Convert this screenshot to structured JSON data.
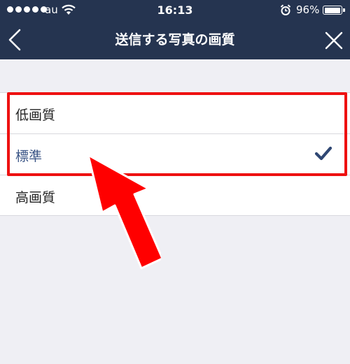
{
  "status_bar": {
    "carrier": "au",
    "time": "16:13",
    "battery_percent": "96%",
    "battery_level": 0.96
  },
  "nav": {
    "title": "送信する写真の画質",
    "back_icon": "chevron-left-icon",
    "close_icon": "close-icon"
  },
  "options": [
    {
      "label": "低画質",
      "selected": false
    },
    {
      "label": "標準",
      "selected": true
    },
    {
      "label": "高画質",
      "selected": false
    }
  ],
  "colors": {
    "nav_background": "#253450",
    "page_background": "#efeff4",
    "selected_text": "#3b5586",
    "checkmark": "#2f4773",
    "annotation_red": "#ee1111"
  }
}
